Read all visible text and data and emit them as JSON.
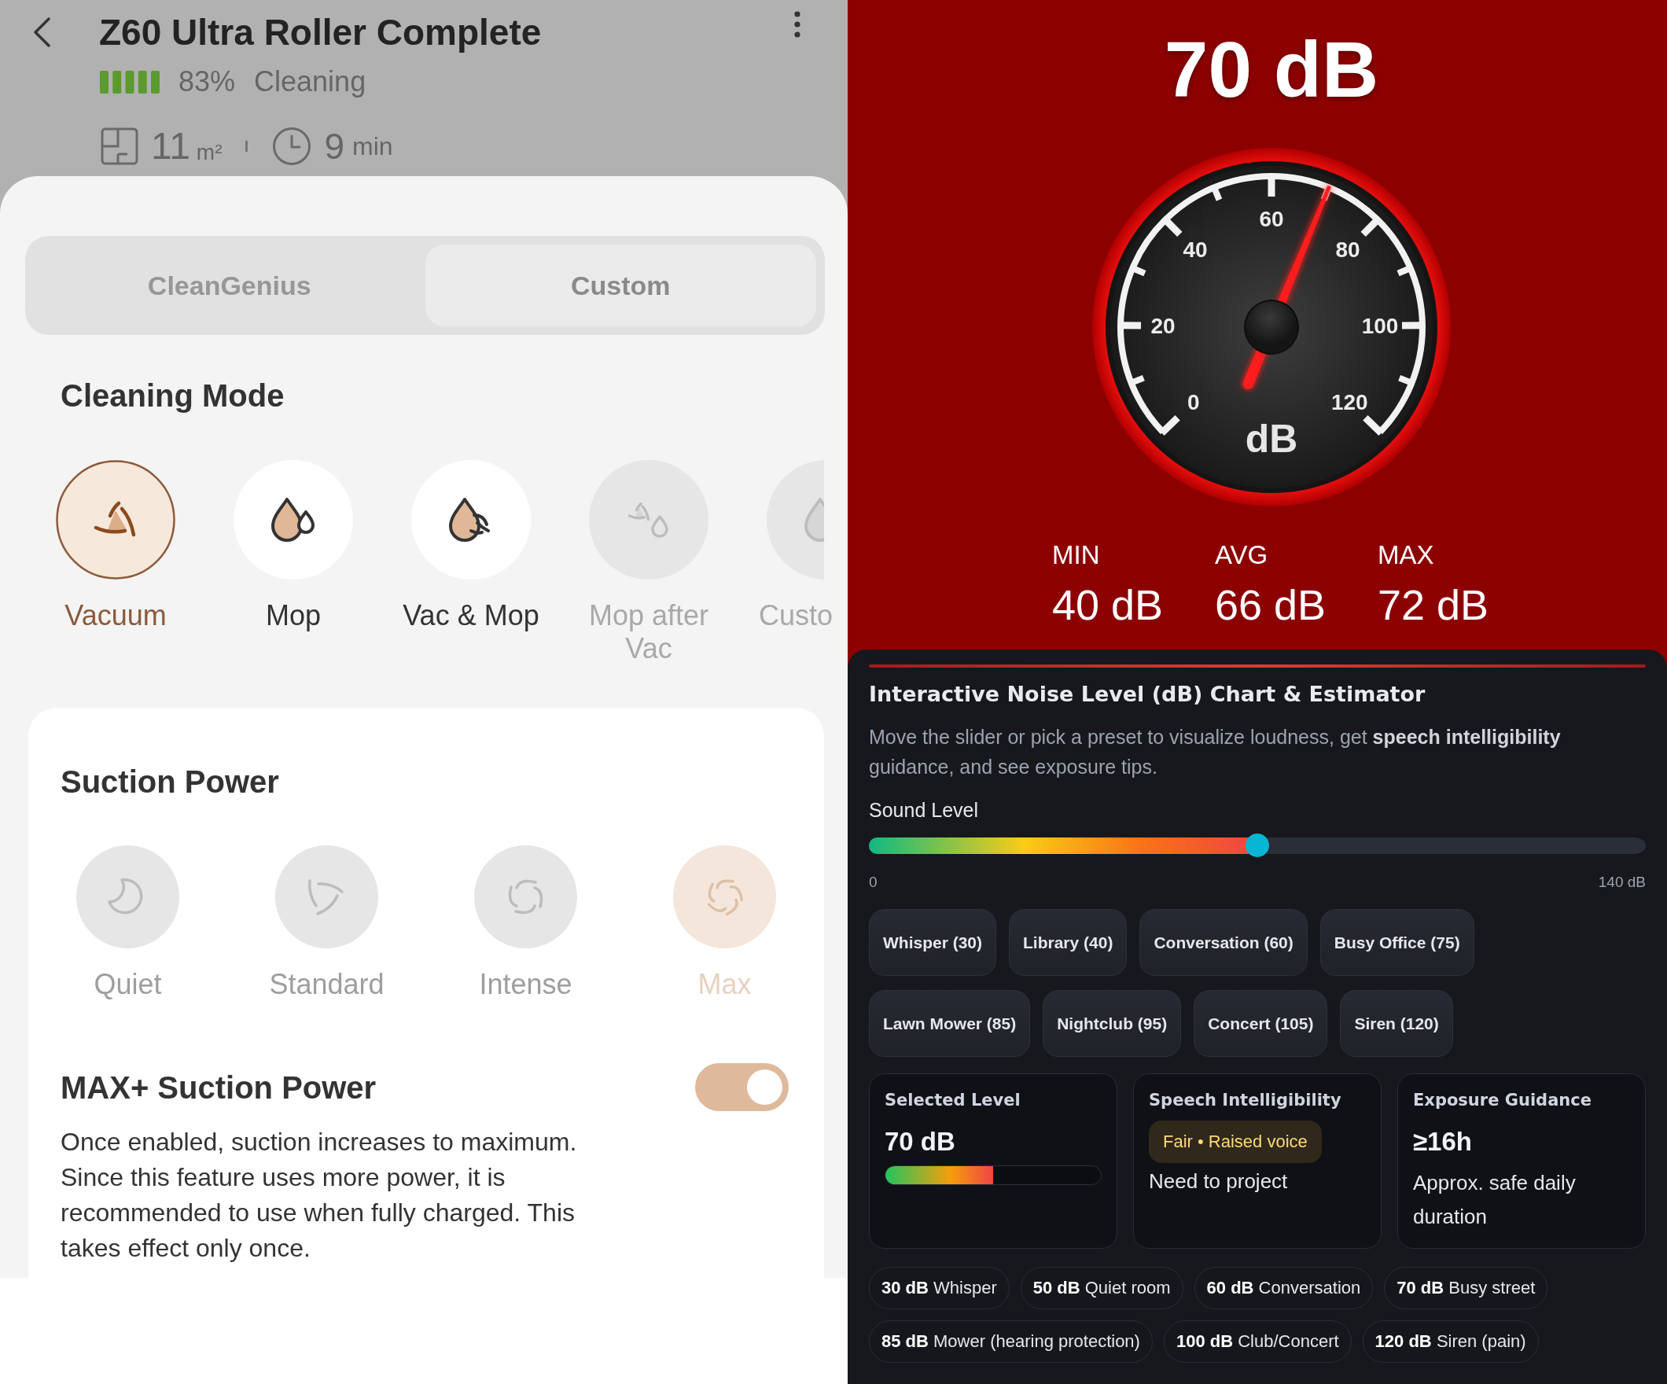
{
  "device_header": {
    "title": "Z60 Ultra Roller Complete",
    "battery": "83%",
    "status": "Cleaning",
    "area": "11",
    "area_unit": "m²",
    "time": "9",
    "time_unit": "min"
  },
  "mode_tabs": [
    {
      "label": "CleanGenius",
      "selected": false
    },
    {
      "label": "Custom",
      "selected": true
    }
  ],
  "cleaning_mode": {
    "title": "Cleaning Mode",
    "modes": [
      {
        "label": "Vacuum",
        "kind": "vacuum",
        "selected": true,
        "disabled": false
      },
      {
        "label": "Mop",
        "kind": "mop",
        "selected": false,
        "disabled": false
      },
      {
        "label": "Vac & Mop",
        "kind": "vac_mop",
        "selected": false,
        "disabled": false
      },
      {
        "label": "Mop after Vac",
        "kind": "mop_after_vac",
        "selected": false,
        "disabled": true
      },
      {
        "label": "Custo",
        "kind": "custom",
        "selected": false,
        "disabled": true
      }
    ]
  },
  "suction_power": {
    "title": "Suction Power",
    "disabled": true,
    "levels": [
      {
        "label": "Quiet",
        "kind": "quiet",
        "selected": false
      },
      {
        "label": "Standard",
        "kind": "standard",
        "selected": false
      },
      {
        "label": "Intense",
        "kind": "intense",
        "selected": false
      },
      {
        "label": "Max",
        "kind": "max",
        "selected": true
      }
    ]
  },
  "max_plus": {
    "title": "MAX+ Suction Power",
    "on": true,
    "description": "Once enabled, suction increases to maximum. Since this feature uses more power, it is recommended to use when fully charged. This takes effect only once."
  },
  "meter": {
    "reading": "70 dB",
    "gauge": {
      "ticks": [
        "0",
        "20",
        "40",
        "60",
        "80",
        "100",
        "120"
      ],
      "unit": "dB",
      "level": 0.5833
    },
    "stats": [
      {
        "label": "MIN",
        "value": "40 dB"
      },
      {
        "label": "AVG",
        "value": "66 dB"
      },
      {
        "label": "MAX",
        "value": "72 dB"
      }
    ]
  },
  "estimator": {
    "title": "Interactive Noise Level (dB) Chart & Estimator",
    "description": "Move the slider or pick a preset to visualize loudness, get **speech intelligibility** guidance, and see exposure tips.",
    "slider": {
      "label": "Sound Level",
      "level": 0.5,
      "min_label": "0",
      "max_label": "140 dB"
    },
    "presets": [
      "Whisper (30)",
      "Library (40)",
      "Conversation (60)",
      "Busy Office (75)",
      "Lawn Mower (85)",
      "Nightclub (95)",
      "Concert (105)",
      "Siren (120)"
    ],
    "cards": [
      {
        "kind": "level",
        "title": "Selected Level",
        "value": "70 dB",
        "level": 0.5
      },
      {
        "kind": "badge",
        "title": "Speech Intelligibility",
        "badge": "Fair • Raised voice",
        "note": "Need to project"
      },
      {
        "kind": "value",
        "title": "Exposure Guidance",
        "value": "≥16h",
        "note": "Approx. safe daily duration"
      }
    ],
    "references": [
      "**30 dB** Whisper",
      "**50 dB** Quiet room",
      "**60 dB** Conversation",
      "**70 dB** Busy street",
      "**85 dB** Mower (hearing protection)",
      "**100 dB** Club/Concert",
      "**120 dB** Siren (pain)"
    ]
  }
}
